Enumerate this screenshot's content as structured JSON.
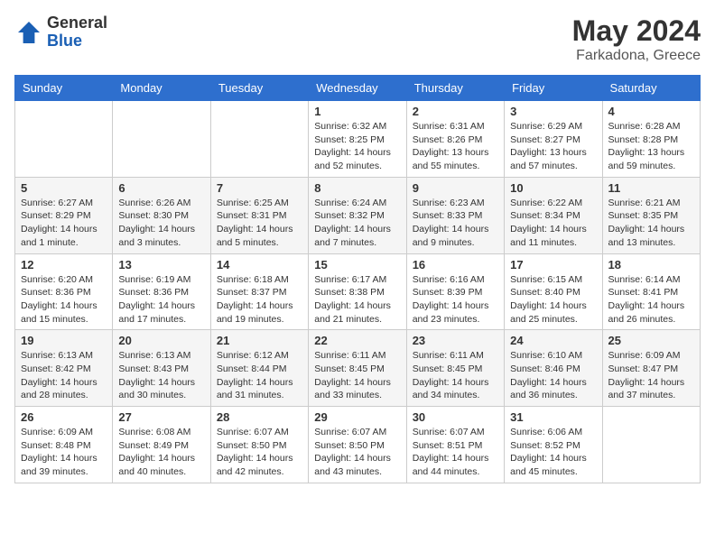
{
  "header": {
    "logo_general": "General",
    "logo_blue": "Blue",
    "month_year": "May 2024",
    "location": "Farkadona, Greece"
  },
  "weekdays": [
    "Sunday",
    "Monday",
    "Tuesday",
    "Wednesday",
    "Thursday",
    "Friday",
    "Saturday"
  ],
  "weeks": [
    [
      {
        "day": "",
        "sunrise": "",
        "sunset": "",
        "daylight": ""
      },
      {
        "day": "",
        "sunrise": "",
        "sunset": "",
        "daylight": ""
      },
      {
        "day": "",
        "sunrise": "",
        "sunset": "",
        "daylight": ""
      },
      {
        "day": "1",
        "sunrise": "Sunrise: 6:32 AM",
        "sunset": "Sunset: 8:25 PM",
        "daylight": "Daylight: 14 hours and 52 minutes."
      },
      {
        "day": "2",
        "sunrise": "Sunrise: 6:31 AM",
        "sunset": "Sunset: 8:26 PM",
        "daylight": "Daylight: 13 hours and 55 minutes."
      },
      {
        "day": "3",
        "sunrise": "Sunrise: 6:29 AM",
        "sunset": "Sunset: 8:27 PM",
        "daylight": "Daylight: 13 hours and 57 minutes."
      },
      {
        "day": "4",
        "sunrise": "Sunrise: 6:28 AM",
        "sunset": "Sunset: 8:28 PM",
        "daylight": "Daylight: 13 hours and 59 minutes."
      }
    ],
    [
      {
        "day": "5",
        "sunrise": "Sunrise: 6:27 AM",
        "sunset": "Sunset: 8:29 PM",
        "daylight": "Daylight: 14 hours and 1 minute."
      },
      {
        "day": "6",
        "sunrise": "Sunrise: 6:26 AM",
        "sunset": "Sunset: 8:30 PM",
        "daylight": "Daylight: 14 hours and 3 minutes."
      },
      {
        "day": "7",
        "sunrise": "Sunrise: 6:25 AM",
        "sunset": "Sunset: 8:31 PM",
        "daylight": "Daylight: 14 hours and 5 minutes."
      },
      {
        "day": "8",
        "sunrise": "Sunrise: 6:24 AM",
        "sunset": "Sunset: 8:32 PM",
        "daylight": "Daylight: 14 hours and 7 minutes."
      },
      {
        "day": "9",
        "sunrise": "Sunrise: 6:23 AM",
        "sunset": "Sunset: 8:33 PM",
        "daylight": "Daylight: 14 hours and 9 minutes."
      },
      {
        "day": "10",
        "sunrise": "Sunrise: 6:22 AM",
        "sunset": "Sunset: 8:34 PM",
        "daylight": "Daylight: 14 hours and 11 minutes."
      },
      {
        "day": "11",
        "sunrise": "Sunrise: 6:21 AM",
        "sunset": "Sunset: 8:35 PM",
        "daylight": "Daylight: 14 hours and 13 minutes."
      }
    ],
    [
      {
        "day": "12",
        "sunrise": "Sunrise: 6:20 AM",
        "sunset": "Sunset: 8:36 PM",
        "daylight": "Daylight: 14 hours and 15 minutes."
      },
      {
        "day": "13",
        "sunrise": "Sunrise: 6:19 AM",
        "sunset": "Sunset: 8:36 PM",
        "daylight": "Daylight: 14 hours and 17 minutes."
      },
      {
        "day": "14",
        "sunrise": "Sunrise: 6:18 AM",
        "sunset": "Sunset: 8:37 PM",
        "daylight": "Daylight: 14 hours and 19 minutes."
      },
      {
        "day": "15",
        "sunrise": "Sunrise: 6:17 AM",
        "sunset": "Sunset: 8:38 PM",
        "daylight": "Daylight: 14 hours and 21 minutes."
      },
      {
        "day": "16",
        "sunrise": "Sunrise: 6:16 AM",
        "sunset": "Sunset: 8:39 PM",
        "daylight": "Daylight: 14 hours and 23 minutes."
      },
      {
        "day": "17",
        "sunrise": "Sunrise: 6:15 AM",
        "sunset": "Sunset: 8:40 PM",
        "daylight": "Daylight: 14 hours and 25 minutes."
      },
      {
        "day": "18",
        "sunrise": "Sunrise: 6:14 AM",
        "sunset": "Sunset: 8:41 PM",
        "daylight": "Daylight: 14 hours and 26 minutes."
      }
    ],
    [
      {
        "day": "19",
        "sunrise": "Sunrise: 6:13 AM",
        "sunset": "Sunset: 8:42 PM",
        "daylight": "Daylight: 14 hours and 28 minutes."
      },
      {
        "day": "20",
        "sunrise": "Sunrise: 6:13 AM",
        "sunset": "Sunset: 8:43 PM",
        "daylight": "Daylight: 14 hours and 30 minutes."
      },
      {
        "day": "21",
        "sunrise": "Sunrise: 6:12 AM",
        "sunset": "Sunset: 8:44 PM",
        "daylight": "Daylight: 14 hours and 31 minutes."
      },
      {
        "day": "22",
        "sunrise": "Sunrise: 6:11 AM",
        "sunset": "Sunset: 8:45 PM",
        "daylight": "Daylight: 14 hours and 33 minutes."
      },
      {
        "day": "23",
        "sunrise": "Sunrise: 6:11 AM",
        "sunset": "Sunset: 8:45 PM",
        "daylight": "Daylight: 14 hours and 34 minutes."
      },
      {
        "day": "24",
        "sunrise": "Sunrise: 6:10 AM",
        "sunset": "Sunset: 8:46 PM",
        "daylight": "Daylight: 14 hours and 36 minutes."
      },
      {
        "day": "25",
        "sunrise": "Sunrise: 6:09 AM",
        "sunset": "Sunset: 8:47 PM",
        "daylight": "Daylight: 14 hours and 37 minutes."
      }
    ],
    [
      {
        "day": "26",
        "sunrise": "Sunrise: 6:09 AM",
        "sunset": "Sunset: 8:48 PM",
        "daylight": "Daylight: 14 hours and 39 minutes."
      },
      {
        "day": "27",
        "sunrise": "Sunrise: 6:08 AM",
        "sunset": "Sunset: 8:49 PM",
        "daylight": "Daylight: 14 hours and 40 minutes."
      },
      {
        "day": "28",
        "sunrise": "Sunrise: 6:07 AM",
        "sunset": "Sunset: 8:50 PM",
        "daylight": "Daylight: 14 hours and 42 minutes."
      },
      {
        "day": "29",
        "sunrise": "Sunrise: 6:07 AM",
        "sunset": "Sunset: 8:50 PM",
        "daylight": "Daylight: 14 hours and 43 minutes."
      },
      {
        "day": "30",
        "sunrise": "Sunrise: 6:07 AM",
        "sunset": "Sunset: 8:51 PM",
        "daylight": "Daylight: 14 hours and 44 minutes."
      },
      {
        "day": "31",
        "sunrise": "Sunrise: 6:06 AM",
        "sunset": "Sunset: 8:52 PM",
        "daylight": "Daylight: 14 hours and 45 minutes."
      },
      {
        "day": "",
        "sunrise": "",
        "sunset": "",
        "daylight": ""
      }
    ]
  ]
}
